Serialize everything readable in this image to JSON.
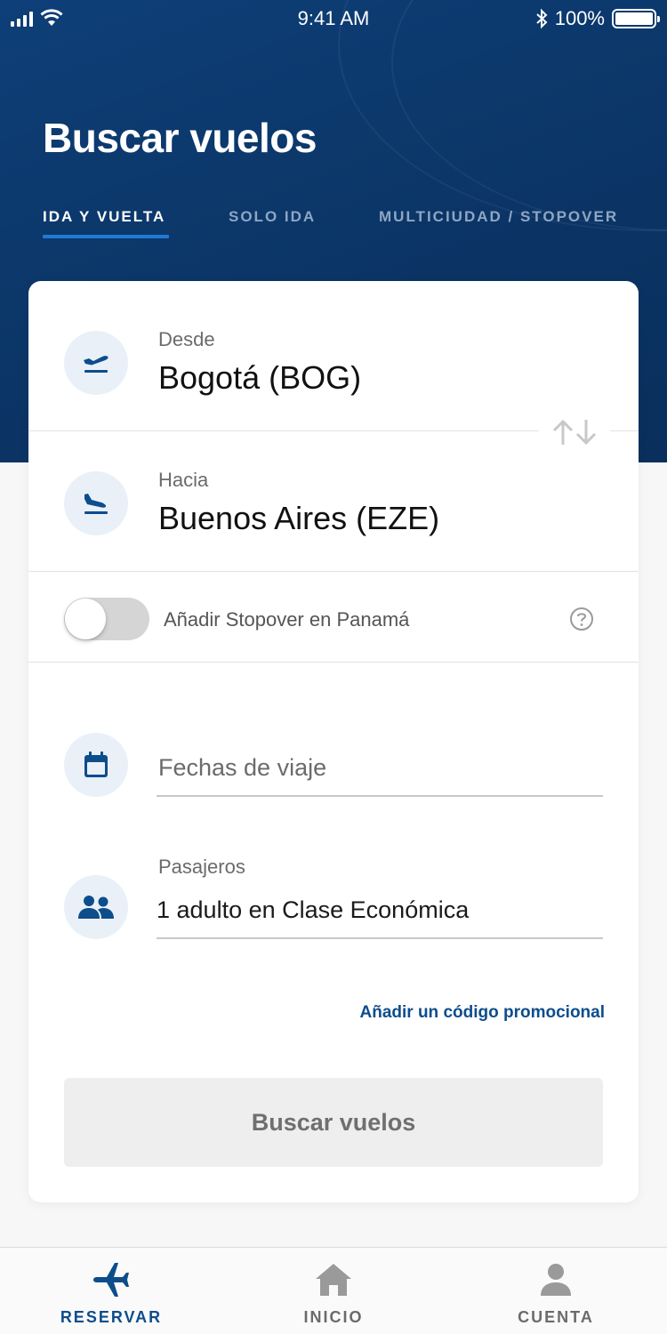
{
  "status_bar": {
    "time": "9:41 AM",
    "battery": "100%"
  },
  "page": {
    "title": "Buscar vuelos"
  },
  "tabs": [
    {
      "label": "IDA Y VUELTA",
      "active": true
    },
    {
      "label": "SOLO IDA",
      "active": false
    },
    {
      "label": "MULTICIUDAD / STOPOVER",
      "active": false
    }
  ],
  "form": {
    "origin": {
      "label": "Desde",
      "value": "Bogotá (BOG)",
      "icon": "plane-takeoff-icon"
    },
    "destination": {
      "label": "Hacia",
      "value": "Buenos Aires (EZE)",
      "icon": "plane-landing-icon"
    },
    "swap_icon": "swap-arrows-icon",
    "stopover": {
      "label": "Añadir Stopover en Panamá",
      "enabled": false
    },
    "dates": {
      "placeholder": "Fechas de viaje",
      "icon": "calendar-icon"
    },
    "passengers": {
      "label": "Pasajeros",
      "value": "1 adulto en Clase Económica",
      "icon": "passengers-icon"
    },
    "promo_link": "Añadir un código promocional",
    "submit_label": "Buscar vuelos"
  },
  "bottom_nav": [
    {
      "label": "RESERVAR",
      "icon": "airplane-icon",
      "active": true
    },
    {
      "label": "INICIO",
      "icon": "home-icon",
      "active": false
    },
    {
      "label": "CUENTA",
      "icon": "user-icon",
      "active": false
    }
  ],
  "colors": {
    "brand_navy": "#0b3566",
    "accent_blue": "#1f7ad6",
    "link_blue": "#0d4d8c"
  }
}
